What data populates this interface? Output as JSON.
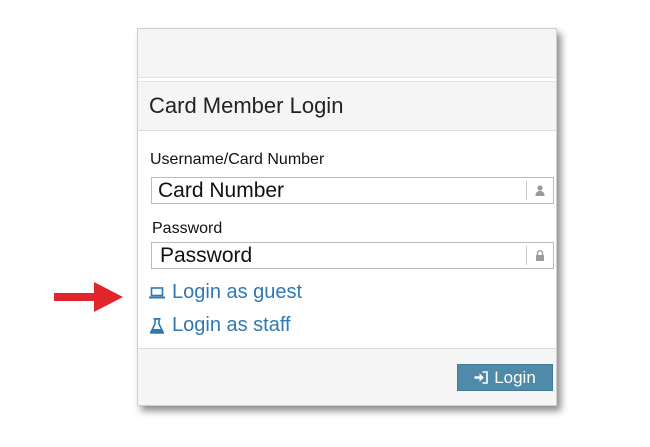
{
  "panel": {
    "title": "Card Member Login"
  },
  "username": {
    "label": "Username/Card Number",
    "placeholder": "Card Number",
    "icon": "user-icon"
  },
  "password": {
    "label": "Password",
    "placeholder": "Password",
    "icon": "lock-icon"
  },
  "links": {
    "guest": {
      "label": "Login as guest",
      "icon": "laptop-icon"
    },
    "staff": {
      "label": "Login as staff",
      "icon": "flask-icon"
    }
  },
  "footer": {
    "login_label": "Login",
    "login_icon": "sign-in-icon"
  },
  "colors": {
    "link": "#2f79b3",
    "button": "#4f8aa8",
    "arrow": "#e0262b"
  }
}
